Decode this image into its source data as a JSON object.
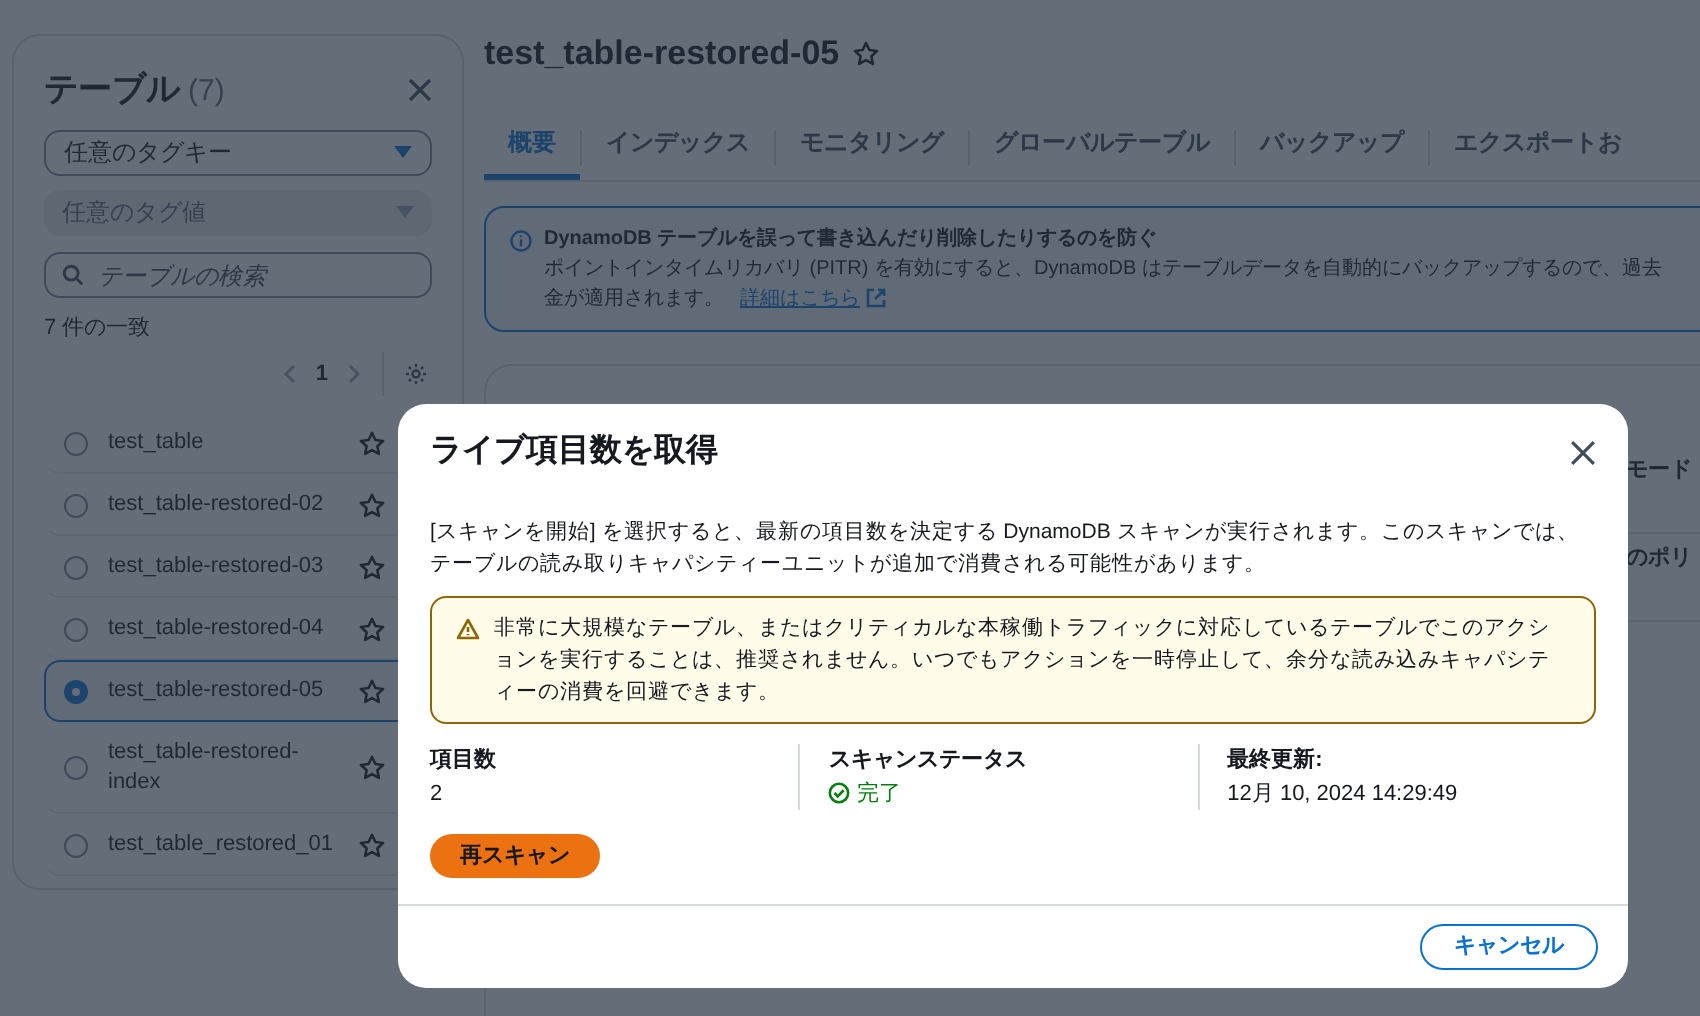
{
  "sidebar": {
    "title": "テーブル",
    "count": "(7)",
    "tag_key": {
      "placeholder": "任意のタグキー"
    },
    "tag_value": {
      "placeholder": "任意のタグ値",
      "disabled": true
    },
    "search": {
      "placeholder": "テーブルの検索"
    },
    "match_count": "7 件の一致",
    "pagination": {
      "page": "1"
    },
    "items": [
      {
        "name": "test_table",
        "selected": false
      },
      {
        "name": "test_table-restored-02",
        "selected": false
      },
      {
        "name": "test_table-restored-03",
        "selected": false
      },
      {
        "name": "test_table-restored-04",
        "selected": false
      },
      {
        "name": "test_table-restored-05",
        "selected": true
      },
      {
        "name": "test_table-restored-index",
        "selected": false
      },
      {
        "name": "test_table_restored_01",
        "selected": false
      }
    ]
  },
  "page_title": "test_table-restored-05",
  "tabs": [
    {
      "label": "概要",
      "selected": true
    },
    {
      "label": "インデックス",
      "selected": false
    },
    {
      "label": "モニタリング",
      "selected": false
    },
    {
      "label": "グローバルテーブル",
      "selected": false
    },
    {
      "label": "バックアップ",
      "selected": false
    },
    {
      "label": "エクスポートお",
      "selected": false
    }
  ],
  "info_alert": {
    "title": "DynamoDB テーブルを誤って書き込んだり削除したりするのを防ぐ",
    "line_1": "ポイントインタイムリカバリ (PITR) を有効にすると、DynamoDB はテーブルデータを自動的にバックアップするので、過去",
    "line_2": "金が適用されます。",
    "link": "詳細はこちら"
  },
  "general_card": {
    "fragments": [
      "モード",
      "のポリ"
    ]
  },
  "modal": {
    "title": "ライブ項目数を取得",
    "description": "[スキャンを開始] を選択すると、最新の項目数を決定する DynamoDB スキャンが実行されます。このスキャンでは、テーブルの読み取りキャパシティーユニットが追加で消費される可能性があります。",
    "warning": "非常に大規模なテーブル、またはクリティカルな本稼働トラフィックに対応しているテーブルでこのアクションを実行することは、推奨されません。いつでもアクションを一時停止して、余分な読み込みキャパシティーの消費を回避できます。",
    "stats": [
      {
        "label": "項目数",
        "value": "2",
        "kind": "text"
      },
      {
        "label": "スキャンステータス",
        "value": "完了",
        "kind": "status"
      },
      {
        "label": "最終更新:",
        "value": "12月 10, 2024 14:29:49",
        "kind": "text"
      }
    ],
    "rescan_button": "再スキャン",
    "cancel_button": "キャンセル"
  }
}
